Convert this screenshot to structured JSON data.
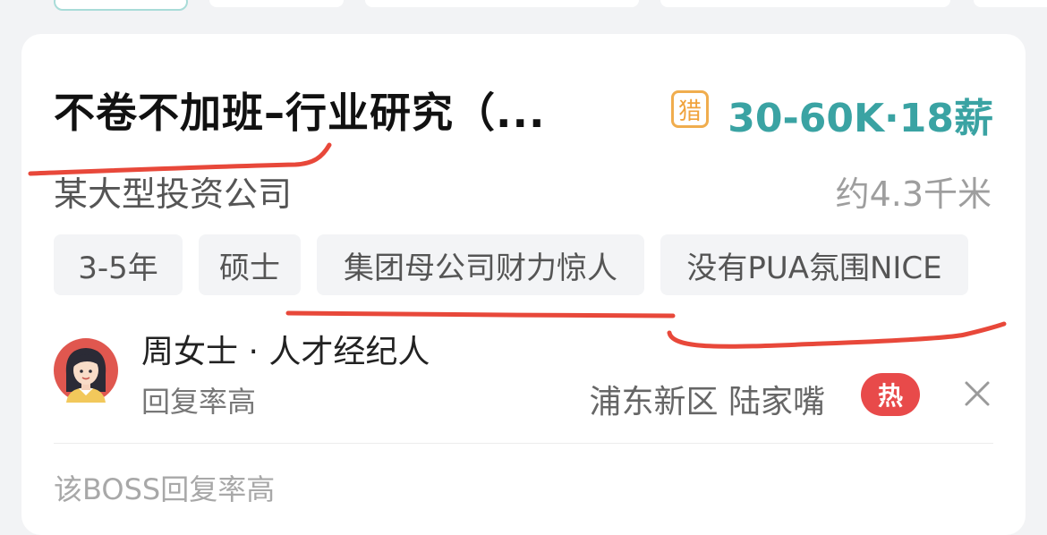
{
  "job": {
    "title": "不卷不加班–行业研究（...",
    "hunter_badge": "猎",
    "salary": "30-60K·18薪",
    "company": "某大型投资公司",
    "distance": "约4.3千米",
    "tags": [
      "3-5年",
      "硕士",
      "集团母公司财力惊人",
      "没有PUA氛围NICE"
    ]
  },
  "recruiter": {
    "name": "周女士 · 人才经纪人",
    "reply_status": "回复率高",
    "location": "浦东新区 陆家嘴",
    "hot_badge": "热"
  },
  "footer": {
    "note": "该BOSS回复率高"
  },
  "colors": {
    "salary": "#3aa3a3",
    "hunter_badge": "#f0a23c",
    "hot_badge": "#e84a4a",
    "annotation_line": "#e8483a"
  },
  "icons": {
    "close": "close-icon",
    "avatar": "avatar"
  }
}
